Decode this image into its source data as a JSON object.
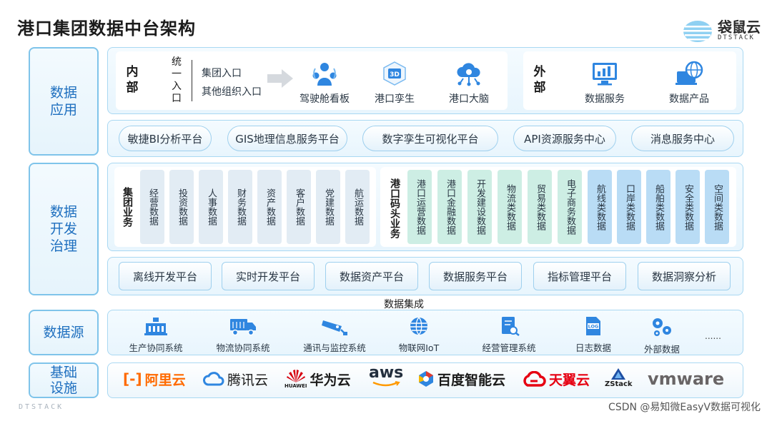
{
  "title": "港口集团数据中台架构",
  "brand": {
    "cn": "袋鼠云",
    "en": "DTSTACK"
  },
  "layers": {
    "app": "数据\n应用",
    "dev": "数据\n开发\n治理",
    "src": "数据源",
    "base": "基础\n设施"
  },
  "app_section": {
    "internal": "内\n部",
    "unified": "统\n一\n入\n口",
    "entry1": "集团入口",
    "entry2": "其他组织入口",
    "items": [
      "驾驶舱看板",
      "港口孪生",
      "港口大脑"
    ],
    "external": "外\n部",
    "ext_items": [
      "数据服务",
      "数据产品"
    ]
  },
  "platforms": [
    "敏捷BI分析平台",
    "GIS地理信息服务平台",
    "数字孪生可视化平台",
    "API资源服务中心",
    "消息服务中心"
  ],
  "group_business": {
    "head": "集团业务",
    "cells": [
      "经营数据",
      "投资数据",
      "人事数据",
      "财务数据",
      "资产数据",
      "客户数据",
      "党建数据",
      "航运数据"
    ]
  },
  "port_business": {
    "head": "港口码头业务",
    "green": [
      "港口运营数据",
      "港口金融数据",
      "开发建设数据",
      "物流类数据",
      "贸易类数据",
      "电子商务数据"
    ],
    "blue": [
      "航线类数据",
      "口岸类数据",
      "船舶类数据",
      "安全类数据",
      "空间类数据"
    ]
  },
  "dev_tools": [
    "离线开发平台",
    "实时开发平台",
    "数据资产平台",
    "数据服务平台",
    "指标管理平台",
    "数据洞察分析"
  ],
  "integration": "数据集成",
  "sources": [
    "生产协同系统",
    "物流协同系统",
    "通讯与监控系统",
    "物联网IoT",
    "经营管理系统",
    "日志数据",
    "外部数据",
    "......"
  ],
  "clouds": {
    "aliyun": "阿里云",
    "tencent": "腾讯云",
    "huawei": "华为云",
    "huawei_sub": "HUAWEI",
    "aws": "aws",
    "baidu": "百度智能云",
    "tianyi": "天翼云",
    "zstack": "ZStack",
    "vmware": "vmware"
  },
  "footer_left": "DTSTACK",
  "footer_right": "CSDN @易知微EasyV数据可视化",
  "colors": {
    "accent": "#1e6fbf",
    "border": "#7fc4ea",
    "green": "#cdeee4",
    "blue": "#b9dcf5"
  }
}
